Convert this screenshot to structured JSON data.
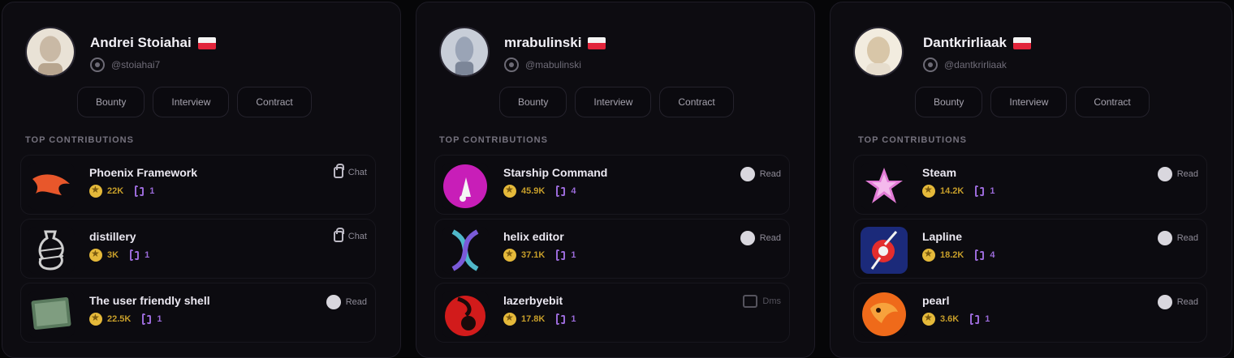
{
  "profiles": [
    {
      "name": "Andrei Stoiahai",
      "handle": "@stoiahai7",
      "avatar_color": "#c9b9a5",
      "buttons": [
        "Bounty",
        "Interview",
        "Contract"
      ],
      "section_label": "TOP CONTRIBUTIONS",
      "repos": [
        {
          "name": "Phoenix Framework",
          "stars": "22K",
          "prs": "1",
          "status": "Chat",
          "status_icon": "lock",
          "logo": "phoenix",
          "logo_color": "#e8572b"
        },
        {
          "name": "distillery",
          "stars": "3K",
          "prs": "1",
          "status": "Chat",
          "status_icon": "lock",
          "logo": "distillery",
          "logo_color": "#cfcfcf"
        },
        {
          "name": "The user friendly shell",
          "stars": "22.5K",
          "prs": "1",
          "status": "Read",
          "status_icon": "circle",
          "logo": "shell",
          "logo_color": "#5a7a5e"
        }
      ]
    },
    {
      "name": "mrabulinski",
      "handle": "@mabulinski",
      "avatar_color": "#9aa4b6",
      "buttons": [
        "Bounty",
        "Interview",
        "Contract"
      ],
      "section_label": "TOP CONTRIBUTIONS",
      "repos": [
        {
          "name": "Starship Command",
          "stars": "45.9K",
          "prs": "4",
          "status": "Read",
          "status_icon": "circle",
          "logo": "starship",
          "logo_color": "#c81eb8"
        },
        {
          "name": "helix editor",
          "stars": "37.1K",
          "prs": "1",
          "status": "Read",
          "status_icon": "circle",
          "logo": "helix",
          "logo_color": "#4fb7c9"
        },
        {
          "name": "lazerbyebit",
          "stars": "17.8K",
          "prs": "1",
          "status": "Dms",
          "status_icon": "box",
          "logo": "lazer",
          "logo_color": "#d21b1b"
        }
      ]
    },
    {
      "name": "Dantkrirliaak",
      "handle": "@dantkrirliaak",
      "avatar_color": "#d8c6a8",
      "buttons": [
        "Bounty",
        "Interview",
        "Contract"
      ],
      "section_label": "TOP CONTRIBUTIONS",
      "repos": [
        {
          "name": "Steam",
          "stars": "14.2K",
          "prs": "1",
          "status": "Read",
          "status_icon": "circle",
          "logo": "steam",
          "logo_color": "#e27bd6"
        },
        {
          "name": "Lapline",
          "stars": "18.2K",
          "prs": "4",
          "status": "Read",
          "status_icon": "circle",
          "logo": "lapline",
          "logo_color": "#1b2a7a"
        },
        {
          "name": "pearl",
          "stars": "3.6K",
          "prs": "1",
          "status": "Read",
          "status_icon": "circle",
          "logo": "pearl",
          "logo_color": "#ef6a1a"
        }
      ]
    }
  ]
}
